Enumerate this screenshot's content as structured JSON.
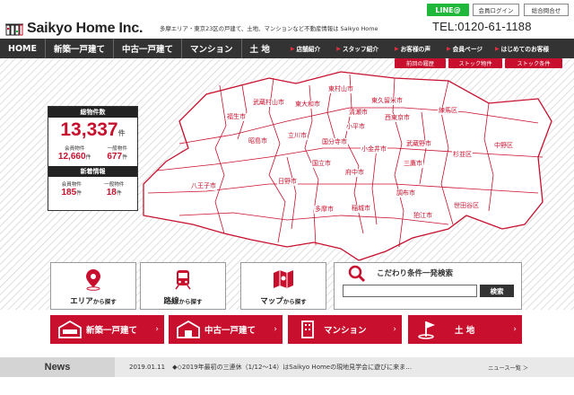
{
  "header": {
    "logo_text": "Saikyo Home Inc.",
    "tagline": "多摩エリア・東京23区の戸建て、土地、マンションなど不動産情報は Saikyo Home",
    "line_label": "LINE@",
    "login_label": "会員ログイン",
    "contact_label": "総合問合せ",
    "tel": "TEL:0120-61-1188"
  },
  "nav": {
    "main": [
      "HOME",
      "新築一戸建て",
      "中古一戸建て",
      "マンション",
      "土 地"
    ],
    "sub": [
      "店舗紹介",
      "スタッフ紹介",
      "お客様の声",
      "会員ページ",
      "はじめてのお客様"
    ],
    "subnav": [
      "前回の履歴",
      "ストック物件",
      "ストック条件"
    ]
  },
  "map": {
    "cities": [
      "東村山市",
      "武蔵村山市",
      "東大和市",
      "東久留米市",
      "清瀬市",
      "練馬区",
      "福生市",
      "小平市",
      "西東京市",
      "昭島市",
      "立川市",
      "国分寺市",
      "小金井市",
      "武蔵野市",
      "中野区",
      "杉並区",
      "国立市",
      "府中市",
      "三鷹市",
      "八王子市",
      "日野市",
      "調布市",
      "世田谷区",
      "多摩市",
      "稲城市",
      "狛江市"
    ]
  },
  "stats": {
    "total_label": "総物件数",
    "total_value": "13,337",
    "unit": "件",
    "member_label": "会員物件",
    "member_value": "12,660",
    "general_label": "一般物件",
    "general_value": "677",
    "new_label": "新着情報",
    "new_member_value": "185",
    "new_general_value": "18"
  },
  "search": {
    "area_main": "エリア",
    "area_sub": "から探す",
    "route_main": "路線",
    "route_sub": "から探す",
    "map_main": "マップ",
    "map_sub": "から探す",
    "keyword_title": "こだわり条件一発検索",
    "keyword_button": "検索",
    "keyword_value": ""
  },
  "categories": [
    "新築一戸建て",
    "中古一戸建て",
    "マンション",
    "土 地"
  ],
  "news": {
    "title": "News",
    "date": "2019.01.11",
    "text": "◆◇2019年最初の三連休（1/12〜14）はSaikyo Homeの現地見学会に遊びに来ま…",
    "more": "ニュース一覧 ＞"
  },
  "colors": {
    "brand_red": "#c8102e",
    "nav_dark": "#333333",
    "line_green": "#1fb83b"
  }
}
